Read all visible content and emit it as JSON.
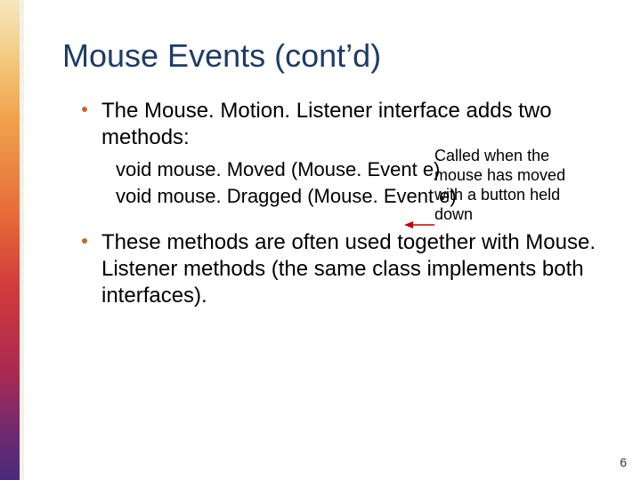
{
  "title": "Mouse Events (cont’d)",
  "bullets": [
    {
      "text": "The Mouse. Motion. Listener interface adds two methods:",
      "methods": [
        "void mouse. Moved (Mouse. Event e)",
        "void mouse. Dragged (Mouse. Event e)"
      ]
    },
    {
      "text": "These methods are often used together with Mouse. Listener methods (the same class implements both interfaces).",
      "methods": []
    }
  ],
  "annotation": "Called when the mouse has moved with a button held down",
  "page_number": "6",
  "colors": {
    "title": "#1f3b66",
    "bullet_dot": "#c06a2a",
    "arrow": "#c00000"
  }
}
